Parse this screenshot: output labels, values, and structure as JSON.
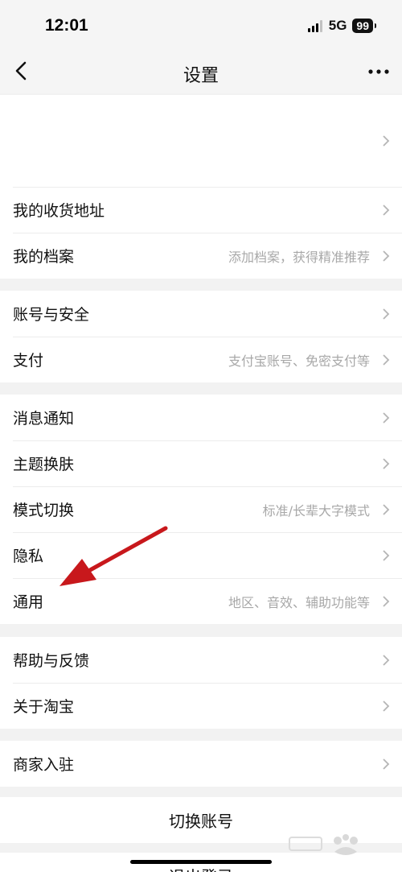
{
  "status_bar": {
    "time": "12:01",
    "network": "5G",
    "battery": "99"
  },
  "header": {
    "title": "设置"
  },
  "sections": [
    {
      "rows": [
        {
          "label": "",
          "hint": ""
        },
        {
          "label": "我的收货地址",
          "hint": ""
        },
        {
          "label": "我的档案",
          "hint": "添加档案，获得精准推荐"
        }
      ]
    },
    {
      "rows": [
        {
          "label": "账号与安全",
          "hint": ""
        },
        {
          "label": "支付",
          "hint": "支付宝账号、免密支付等"
        }
      ]
    },
    {
      "rows": [
        {
          "label": "消息通知",
          "hint": ""
        },
        {
          "label": "主题换肤",
          "hint": ""
        },
        {
          "label": "模式切换",
          "hint": "标准/长辈大字模式"
        },
        {
          "label": "隐私",
          "hint": ""
        },
        {
          "label": "通用",
          "hint": "地区、音效、辅助功能等"
        }
      ]
    },
    {
      "rows": [
        {
          "label": "帮助与反馈",
          "hint": ""
        },
        {
          "label": "关于淘宝",
          "hint": ""
        }
      ]
    },
    {
      "rows": [
        {
          "label": "商家入驻",
          "hint": ""
        }
      ]
    }
  ],
  "switch_account": {
    "label": "切换账号"
  },
  "logout": {
    "label": "退出登录"
  },
  "colors": {
    "arrow": "#c8181c",
    "background": "#f2f2f2",
    "hint": "#a8a8a8"
  }
}
